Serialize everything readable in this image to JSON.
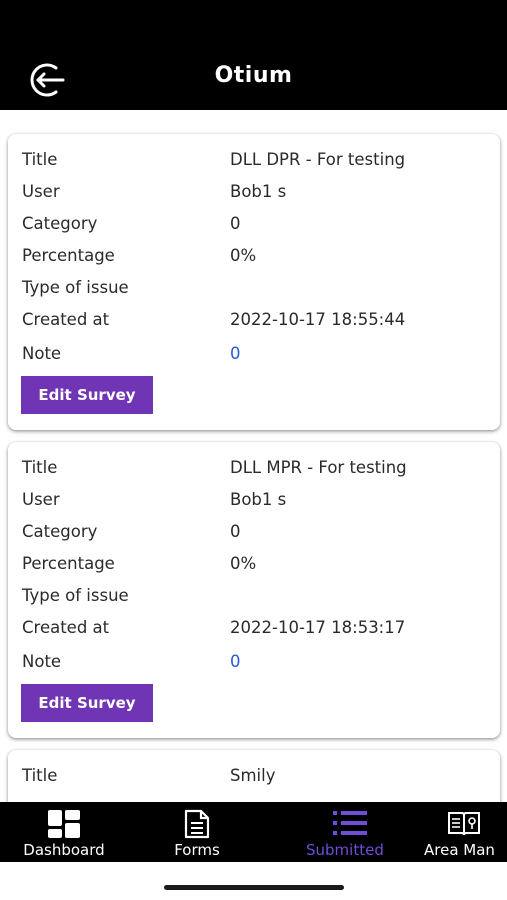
{
  "header": {
    "title": "Otium"
  },
  "labels": {
    "title": "Title",
    "user": "User",
    "category": "Category",
    "percentage": "Percentage",
    "type_of_issue": "Type of issue",
    "created_at": "Created at",
    "note": "Note"
  },
  "surveys": [
    {
      "title": "DLL DPR - For testing",
      "user": "Bob1 s",
      "category": "0",
      "percentage": "0%",
      "type_of_issue": "",
      "created_at": "2022-10-17 18:55:44",
      "note": "0",
      "edit_label": "Edit Survey"
    },
    {
      "title": "DLL MPR - For testing",
      "user": "Bob1 s",
      "category": "0",
      "percentage": "0%",
      "type_of_issue": "",
      "created_at": "2022-10-17 18:53:17",
      "note": "0",
      "edit_label": "Edit Survey"
    },
    {
      "title": "Smily"
    }
  ],
  "tabs": [
    {
      "label": "Dashboard",
      "icon": "dashboard-icon"
    },
    {
      "label": "Forms",
      "icon": "document-icon"
    },
    {
      "label": "Submitted",
      "icon": "list-icon",
      "active": true
    },
    {
      "label": "Area Man",
      "icon": "book-map-icon"
    }
  ],
  "colors": {
    "header_bg": "#000000",
    "button_bg": "#6f35b5",
    "active_tab": "#6f4dd8",
    "note_value": "#2a5bd7"
  }
}
